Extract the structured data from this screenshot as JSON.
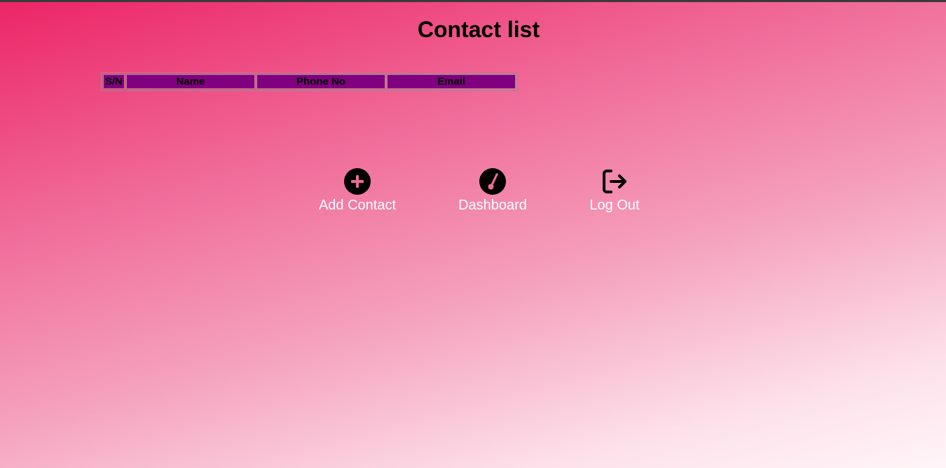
{
  "header": {
    "title": "Contact list"
  },
  "table": {
    "columns": [
      "S/N",
      "Name",
      "Phone No",
      "Email"
    ],
    "rows": []
  },
  "actions": [
    {
      "label": "Add Contact",
      "icon": "plus-circle-icon"
    },
    {
      "label": "Dashboard",
      "icon": "gauge-icon"
    },
    {
      "label": "Log Out",
      "icon": "logout-icon"
    }
  ],
  "colors": {
    "header_cell": "#800080",
    "gradient_start": "#ec2567",
    "gradient_end": "#fff5f8",
    "label_text": "#ffffff",
    "accent_pink": "#f06a98"
  }
}
